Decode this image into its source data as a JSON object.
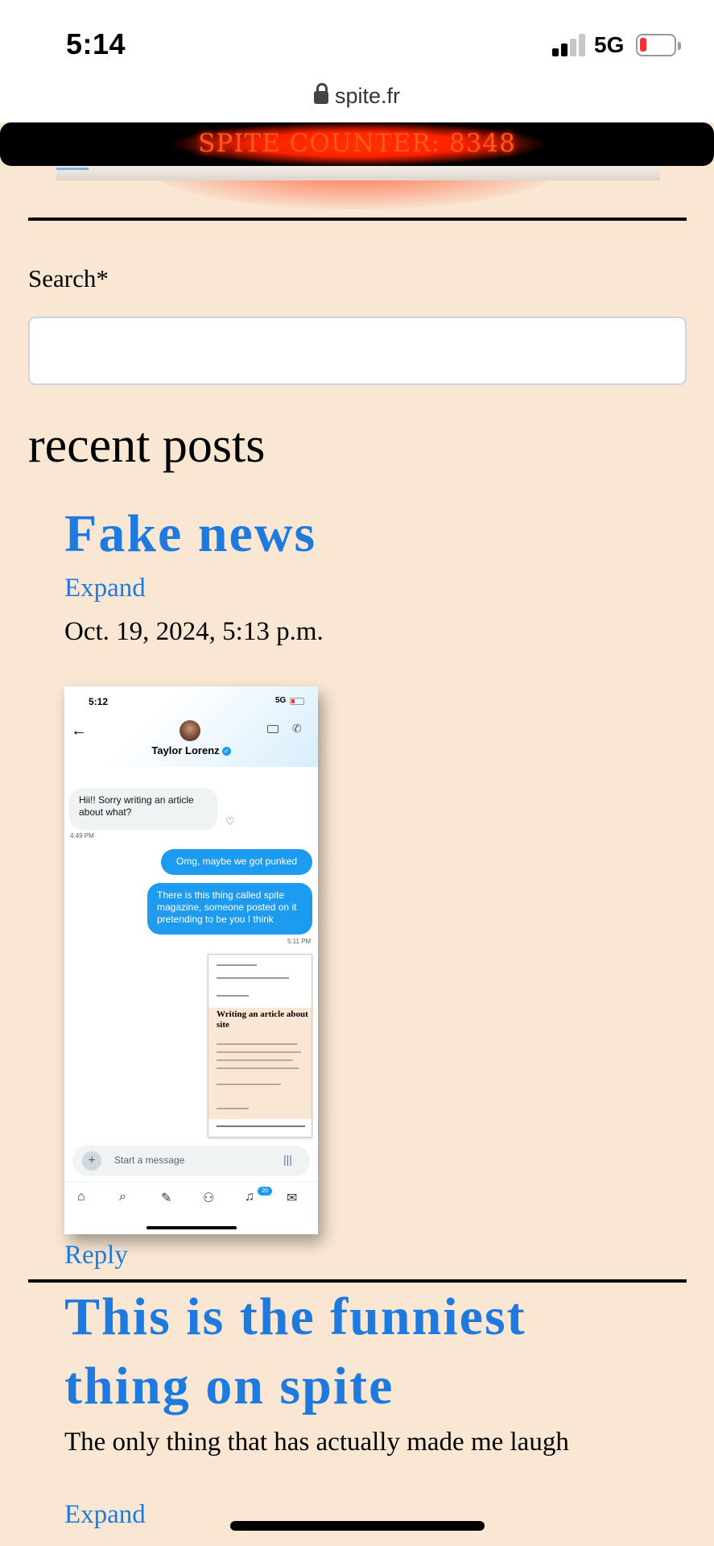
{
  "status_bar": {
    "time": "5:14",
    "network": "5G"
  },
  "url_bar": {
    "domain": "spite.fr"
  },
  "banner": {
    "text": "SPITE COUNTER: 8348"
  },
  "search": {
    "label": "Search*",
    "placeholder": ""
  },
  "recent_posts": {
    "title": "recent posts",
    "posts": [
      {
        "title": "Fake news",
        "expand_label": "Expand",
        "date": "Oct. 19, 2024, 5:13 p.m.",
        "reply_label": "Reply",
        "embedded_screenshot": {
          "time": "5:12",
          "network": "5G",
          "contact_name": "Taylor Lorenz",
          "messages": [
            {
              "from": "them",
              "text": "Hii!! Sorry writing an article about what?",
              "time": "4:49 PM"
            },
            {
              "from": "me",
              "text": "Omg, maybe we got punked"
            },
            {
              "from": "me",
              "text": "There is this thing called spite magazine, someone posted on it pretending to be you I think",
              "time": "5:11 PM"
            }
          ],
          "attachment_title": "Writing an article about site",
          "compose_placeholder": "Start a message",
          "notifications_badge": "20"
        }
      },
      {
        "title_line1": "This is the funniest",
        "title_line2": "thing on spite",
        "excerpt": "The only thing that has actually made me laugh",
        "expand_label": "Expand"
      }
    ]
  },
  "colors": {
    "background": "#f9e7d4",
    "link": "#1f7ae0",
    "banner_text": "#ff3b00"
  }
}
